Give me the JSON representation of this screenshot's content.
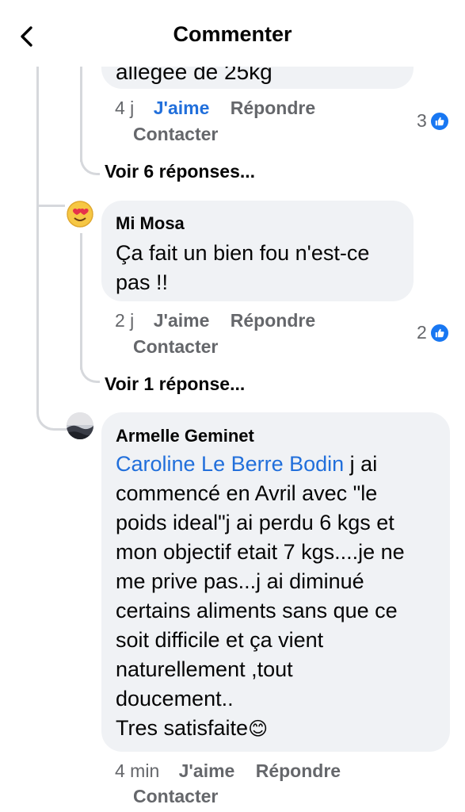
{
  "header": {
    "title": "Commenter"
  },
  "comments": [
    {
      "partial_text": "allégée de 25kg",
      "time": "4 j",
      "like_label": "J'aime",
      "reply_label": "Répondre",
      "contact_label": "Contacter",
      "reaction_count": "3",
      "view_replies": "Voir 6 réponses..."
    },
    {
      "author": "Mi Mosa",
      "text_line1": "Ça fait un bien fou n'est-ce",
      "text_line2": "pas !!",
      "time": "2 j",
      "like_label": "J'aime",
      "reply_label": "Répondre",
      "contact_label": "Contacter",
      "reaction_count": "2",
      "view_replies": "Voir 1 réponse..."
    },
    {
      "author": "Armelle Geminet",
      "mention": "Caroline Le Berre Bodin",
      "lines": [
        " j ai",
        "commencé en Avril avec \"le",
        "poids ideal\"j ai perdu 6 kgs et",
        "mon objectif etait 7 kgs....je ne",
        "me prive pas...j ai diminué",
        "certains aliments sans que ce",
        "soit difficile et ça vient",
        "naturellement ,tout",
        "doucement..",
        "Tres satisfaite"
      ],
      "emoji": "😊",
      "time": "4 min",
      "like_label": "J'aime",
      "reply_label": "Répondre",
      "contact_label": "Contacter"
    }
  ],
  "colors": {
    "accent": "#216fdb",
    "bubble": "#f0f2f5",
    "meta": "#65676b",
    "thread_line": "#d6d8dc"
  }
}
